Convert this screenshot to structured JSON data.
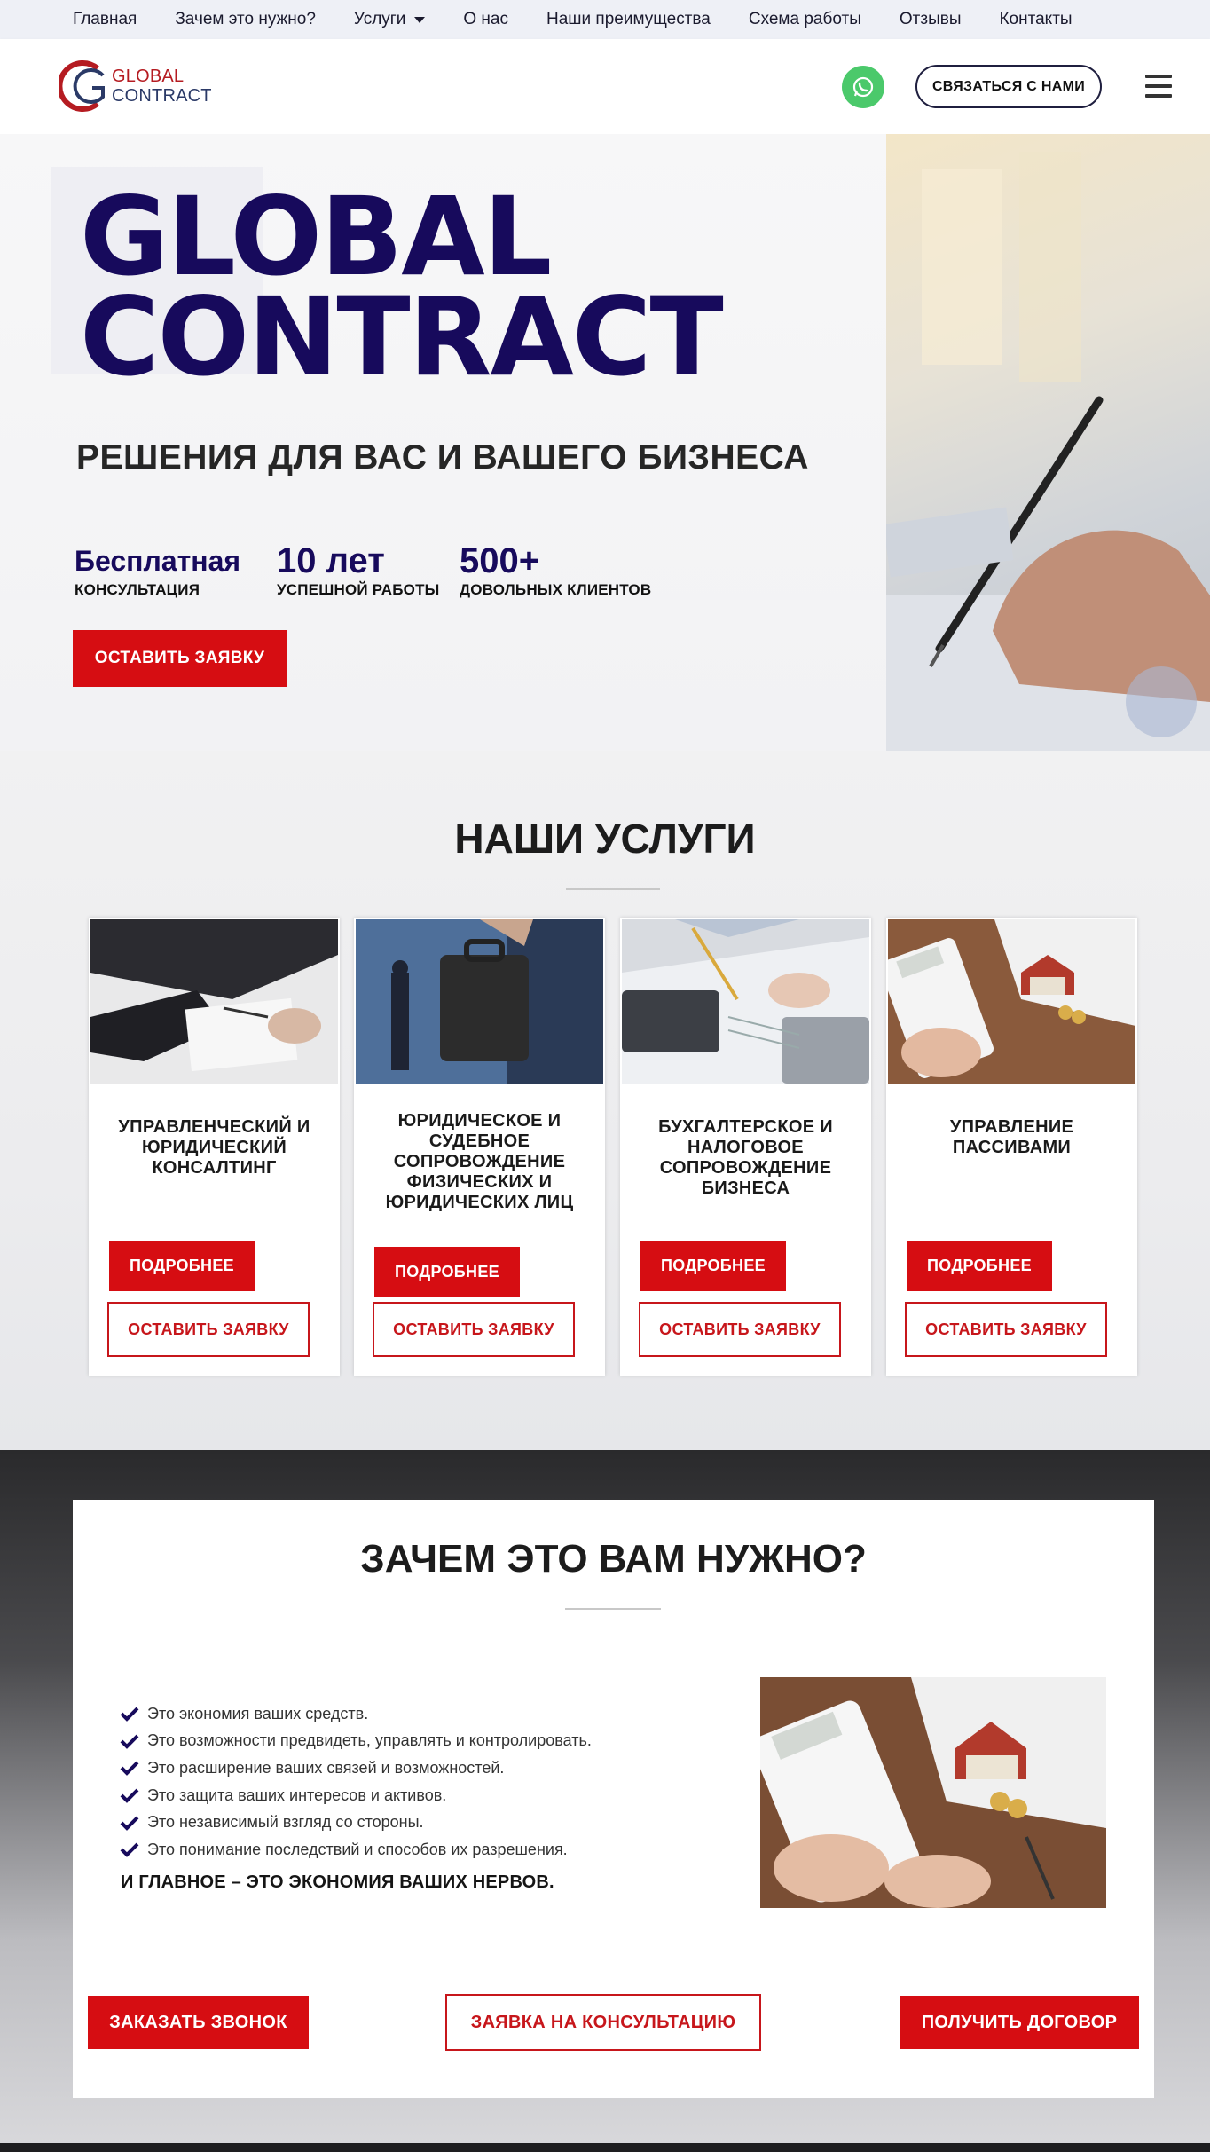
{
  "nav": {
    "items": [
      "Главная",
      "Зачем это нужно?",
      "Услуги",
      "О нас",
      "Наши преимущества",
      "Схема работы",
      "Отзывы",
      "Контакты"
    ]
  },
  "header": {
    "logo_line1": "GLOBAL",
    "logo_line2": "CONTRACT",
    "contact_button": "СВЯЗАТЬСЯ С НАМИ"
  },
  "hero": {
    "title_line1": "GLOBAL",
    "title_line2": "CONTRACT",
    "subtitle": "РЕШЕНИЯ ДЛЯ ВАС И ВАШЕГО БИЗНЕСА",
    "stats": [
      {
        "value": "Бесплатная",
        "label": "КОНСУЛЬТАЦИЯ"
      },
      {
        "value": "10 лет",
        "label": "УСПЕШНОЙ РАБОТЫ"
      },
      {
        "value": "500+",
        "label": "ДОВОЛЬНЫХ КЛИЕНТОВ"
      }
    ],
    "cta": "ОСТАВИТЬ ЗАЯВКУ"
  },
  "services": {
    "title": "НАШИ УСЛУГИ",
    "cards": [
      {
        "title": "УПРАВЛЕНЧЕСКИЙ И ЮРИДИЧЕСКИЙ КОНСАЛТИНГ",
        "more": "ПОДРОБНЕЕ",
        "request": "ОСТАВИТЬ ЗАЯВКУ"
      },
      {
        "title": "ЮРИДИЧЕСКОЕ И СУДЕБНОЕ СОПРОВОЖДЕНИЕ ФИЗИЧЕСКИХ И ЮРИДИЧЕСКИХ ЛИЦ",
        "more": "ПОДРОБНЕЕ",
        "request": "ОСТАВИТЬ ЗАЯВКУ"
      },
      {
        "title": "БУХГАЛТЕРСКОЕ И НАЛОГОВОЕ СОПРОВОЖДЕНИЕ БИЗНЕСА",
        "more": "ПОДРОБНЕЕ",
        "request": "ОСТАВИТЬ ЗАЯВКУ"
      },
      {
        "title": "УПРАВЛЕНИЕ ПАССИВАМИ",
        "more": "ПОДРОБНЕЕ",
        "request": "ОСТАВИТЬ ЗАЯВКУ"
      }
    ]
  },
  "why": {
    "title": "ЗАЧЕМ ЭТО ВАМ НУЖНО?",
    "points": [
      "Это экономия ваших средств.",
      "Это возможности предвидеть, управлять и контролировать.",
      "Это расширение ваших связей и возможностей.",
      "Это защита ваших интересов и активов.",
      "Это независимый взгляд со стороны.",
      "Это понимание последствий и способов их разрешения."
    ],
    "main": "И ГЛАВНОЕ – ЭТО ЭКОНОМИЯ ВАШИХ НЕРВОВ.",
    "buttons": {
      "call": "ЗАКАЗАТЬ ЗВОНОК",
      "consult": "ЗАЯВКА НА КОНСУЛЬТАЦИЮ",
      "contract": "ПОЛУЧИТЬ ДОГОВОР"
    }
  },
  "colors": {
    "brand_red": "#d60d12",
    "brand_navy": "#170a5c",
    "whatsapp": "#4bc96b"
  }
}
